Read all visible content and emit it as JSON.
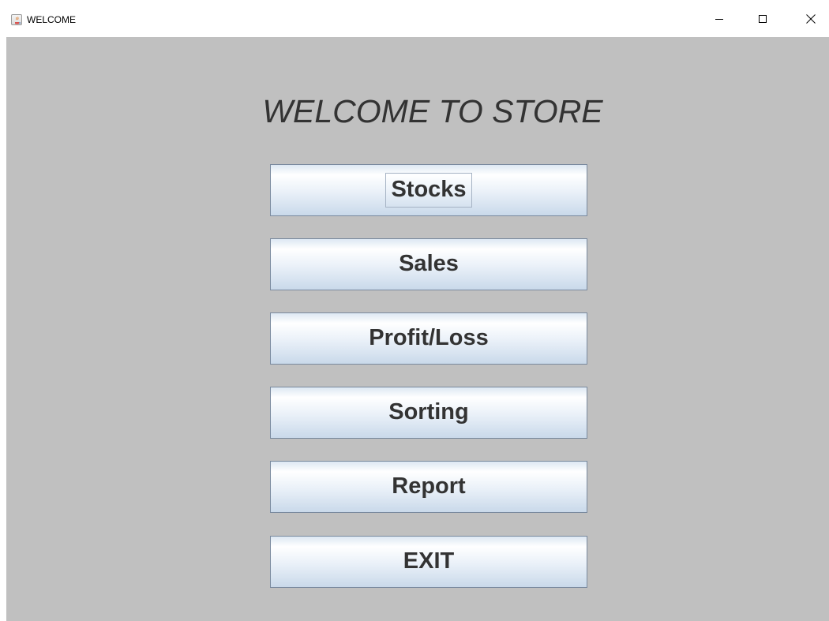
{
  "window": {
    "title": "WELCOME"
  },
  "main": {
    "heading": "WELCOME TO STORE",
    "buttons": [
      {
        "label": "Stocks",
        "focused": true
      },
      {
        "label": "Sales"
      },
      {
        "label": "Profit/Loss"
      },
      {
        "label": "Sorting"
      },
      {
        "label": "Report"
      },
      {
        "label": "EXIT"
      }
    ]
  },
  "colors": {
    "content_background": "#c0c0c0",
    "text": "#333333",
    "button_border": "#7a8a9e",
    "button_gradient_bottom": "#c9d9ea"
  },
  "icons": {
    "app": "java-coffee-icon",
    "minimize": "minimize-icon",
    "maximize": "maximize-icon",
    "close": "close-icon"
  }
}
